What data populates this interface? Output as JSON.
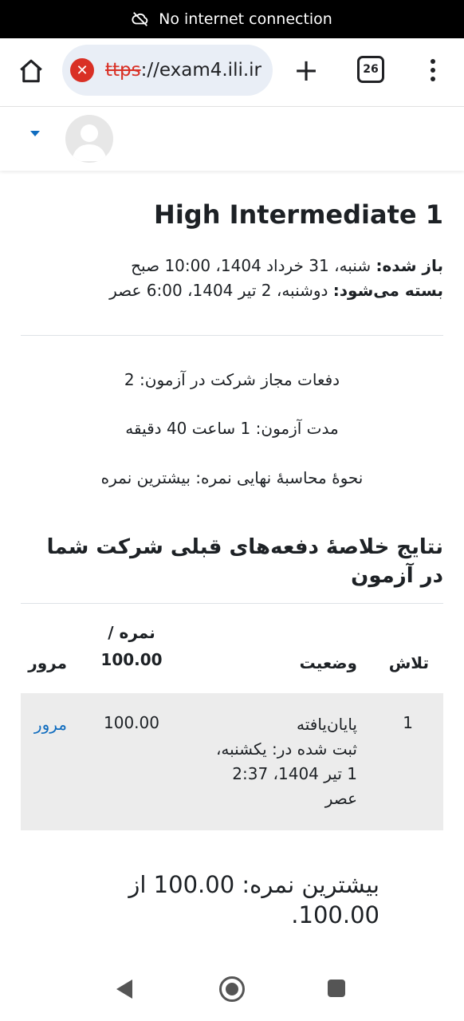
{
  "status_bar": {
    "message": "No internet connection",
    "icon": "cloud-off-icon"
  },
  "browser": {
    "url_scheme": "ttps",
    "url_rest": "://exam4.ili.ir",
    "tab_count": "26"
  },
  "quiz": {
    "title": "High Intermediate 1",
    "opened_label": "باز شده:",
    "opened_value": "شنبه، 31 خرداد 1404، 10:00 صبح",
    "closes_label": "بسته می‌شود:",
    "closes_value": "دوشنبه، 2 تیر 1404، 6:00 عصر",
    "attempts_allowed": "دفعات مجاز شرکت در آزمون: 2",
    "time_limit": "مدت آزمون: 1 ساعت 40 دقیقه",
    "grading_method": "نحوهٔ محاسبهٔ نهایی نمره: بیشترین نمره",
    "summary_heading": "نتایج خلاصهٔ دفعه‌های قبلی شرکت شما در آزمون"
  },
  "table": {
    "headers": {
      "attempt": "تلاش",
      "state": "وضعیت",
      "grade_line1": "نمره /",
      "grade_line2": "100.00",
      "review": "مرور"
    },
    "rows": [
      {
        "attempt": "1",
        "state_line1": "پایان‌یافته",
        "state_line2": "ثبت شده در: یکشنبه،",
        "state_line3": "1 تیر 1404، 2:37",
        "state_line4": "عصر",
        "grade": "100.00",
        "review": "مرور"
      }
    ]
  },
  "best_grade": "بیشترین نمره: 100.00 از 100.00."
}
